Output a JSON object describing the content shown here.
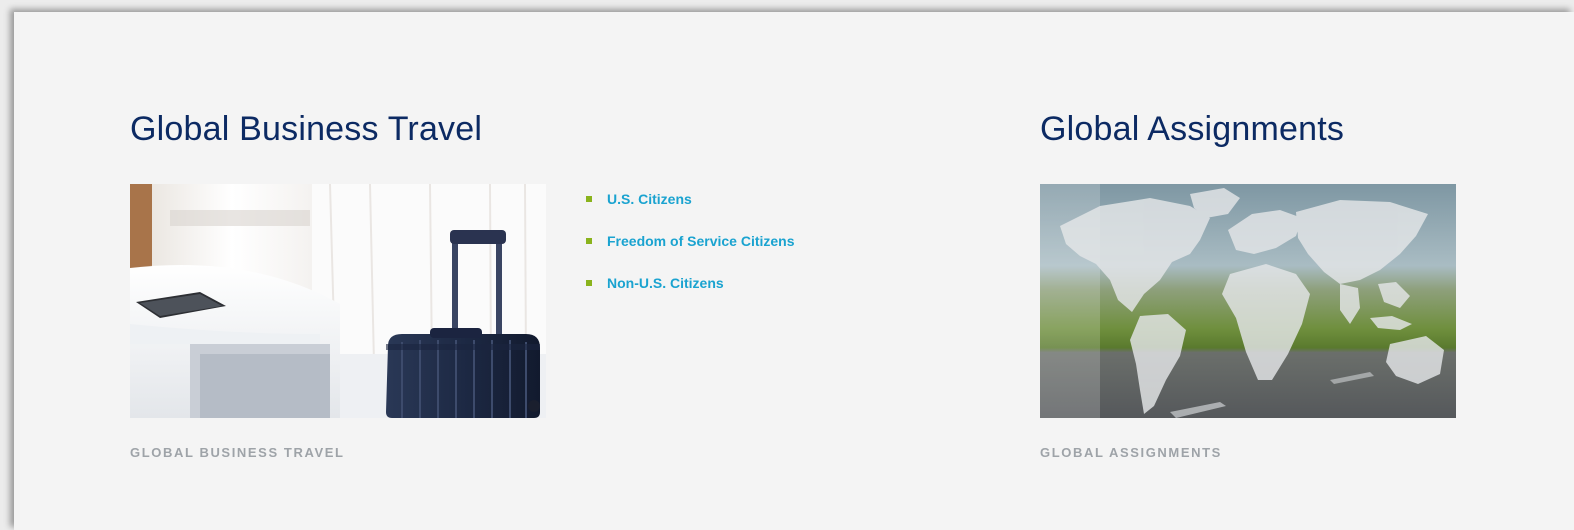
{
  "sections": {
    "business_travel": {
      "title": "Global Business Travel",
      "image_alt": "hotel-room-with-suitcase",
      "caption": "GLOBAL BUSINESS TRAVEL",
      "links": [
        {
          "label": "U.S. Citizens"
        },
        {
          "label": "Freedom of Service Citizens"
        },
        {
          "label": "Non-U.S. Citizens"
        }
      ]
    },
    "assignments": {
      "title": "Global Assignments",
      "image_alt": "world-map-over-road",
      "caption": "GLOBAL ASSIGNMENTS"
    }
  },
  "colors": {
    "title": "#0c2a63",
    "link": "#1aa3d0",
    "bullet": "#8ab31c",
    "caption": "#9ea3a8",
    "panel_bg": "#f4f4f4"
  }
}
